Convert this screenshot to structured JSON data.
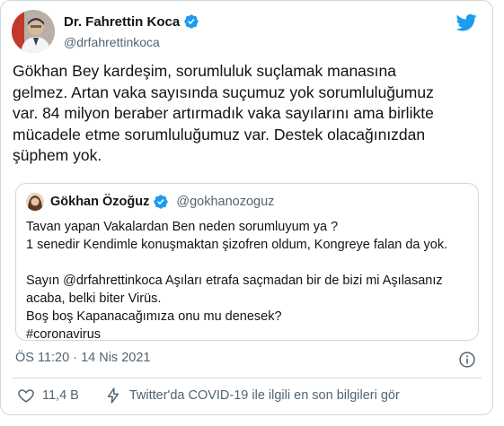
{
  "author": {
    "name": "Dr. Fahrettin Koca",
    "handle": "@drfahrettinkoca",
    "verified_icon": "verified-badge-icon"
  },
  "tweet": {
    "lines": [
      "Gökhan Bey kardeşim, sorumluluk suçlamak manasına",
      "gelmez. Artan vaka sayısında suçumuz yok sorumluluğumuz",
      "var. 84 milyon beraber artırmadık vaka sayılarını ama birlikte",
      "mücadele etme sorumluluğumuz var. Destek olacağınızdan",
      "şüphem yok."
    ]
  },
  "quoted": {
    "name": "Gökhan Özoğuz",
    "handle": "@gokhanozoguz",
    "lines": [
      "Tavan yapan Vakalardan Ben neden sorumluyum ya ?",
      "1 senedir Kendimle konuşmaktan şizofren oldum, Kongreye falan da yok.",
      "",
      "Sayın @drfahrettinkoca Aşıları etrafa saçmadan bir de bizi mi Aşılasanız",
      "acaba, belki biter Virüs.",
      "Boş boş Kapanacağımıza onu mu denesek?",
      "#coronavirus"
    ]
  },
  "meta": {
    "timestamp": "ÖS 11:20 · 14 Nis 2021"
  },
  "actions": {
    "likes": "11,4 B",
    "covid_label": "Twitter'da COVID-19 ile ilgili en son bilgileri gör"
  },
  "colors": {
    "twitter_blue": "#1d9bf0",
    "secondary_text": "#536471",
    "border": "#cfd9de"
  }
}
